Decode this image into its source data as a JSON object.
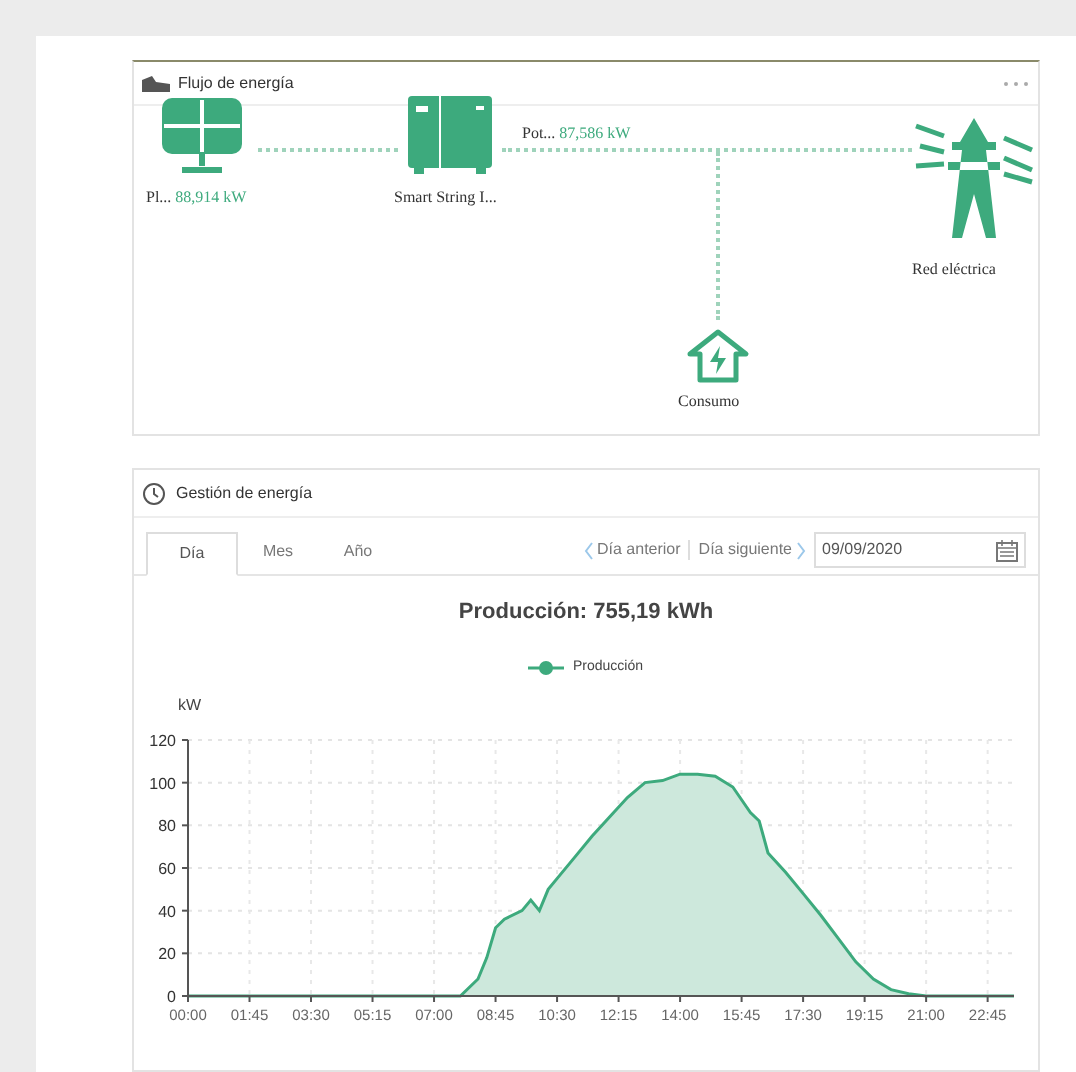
{
  "energy_flow": {
    "title": "Flujo de energía",
    "nodes": [
      {
        "kind": "solar",
        "name": "Pl...",
        "value": "88,914 kW"
      },
      {
        "kind": "inverter",
        "name": "Smart String I..."
      },
      {
        "kind": "house",
        "name": "Consumo"
      },
      {
        "kind": "grid",
        "name": "Red eléctrica"
      }
    ],
    "line_label": {
      "name": "Pot...",
      "value": "87,586 kW"
    }
  },
  "energy_management": {
    "title": "Gestión de energía",
    "tabs": [
      {
        "label": "Día",
        "selected": true
      },
      {
        "label": "Mes",
        "selected": false
      },
      {
        "label": "Año",
        "selected": false
      }
    ],
    "prev": "Día anterior",
    "next": "Día siguiente",
    "date": "09/09/2020",
    "chart_data": {
      "type": "area",
      "title": "Producción: 755,19 kWh",
      "ylabel": "kW",
      "x": [
        0,
        7.75,
        8.25,
        8.5,
        8.75,
        9.0,
        9.5,
        9.75,
        10.0,
        10.25,
        10.5,
        11.0,
        11.5,
        12.0,
        12.5,
        13.0,
        13.5,
        14.0,
        14.5,
        15.0,
        15.5,
        16.0,
        16.25,
        16.5,
        17.0,
        17.5,
        18.0,
        18.5,
        19.0,
        19.5,
        20.0,
        20.5,
        21.0,
        23.5
      ],
      "series": [
        {
          "name": "Producción",
          "color": "#3daa7d",
          "values": [
            0,
            0,
            8,
            18,
            32,
            36,
            40,
            45,
            40,
            50,
            55,
            65,
            75,
            84,
            93,
            100,
            101,
            104,
            104,
            103,
            98,
            86,
            82,
            67,
            58,
            48,
            38,
            27,
            16,
            8,
            3,
            1,
            0,
            0
          ]
        }
      ],
      "xlim": [
        0,
        23.5
      ],
      "ylim": [
        0,
        120
      ],
      "grid": true,
      "xticks": [
        {
          "value": 0,
          "label": "00:00"
        },
        {
          "value": 1.75,
          "label": "01:45"
        },
        {
          "value": 3.5,
          "label": "03:30"
        },
        {
          "value": 5.25,
          "label": "05:15"
        },
        {
          "value": 7,
          "label": "07:00"
        },
        {
          "value": 8.75,
          "label": "08:45"
        },
        {
          "value": 10.5,
          "label": "10:30"
        },
        {
          "value": 12.25,
          "label": "12:15"
        },
        {
          "value": 14,
          "label": "14:00"
        },
        {
          "value": 15.75,
          "label": "15:45"
        },
        {
          "value": 17.5,
          "label": "17:30"
        },
        {
          "value": 19.25,
          "label": "19:15"
        },
        {
          "value": 21,
          "label": "21:00"
        },
        {
          "value": 22.75,
          "label": "22:45"
        }
      ],
      "yticks": [
        0,
        20,
        40,
        60,
        80,
        100,
        120
      ]
    }
  }
}
